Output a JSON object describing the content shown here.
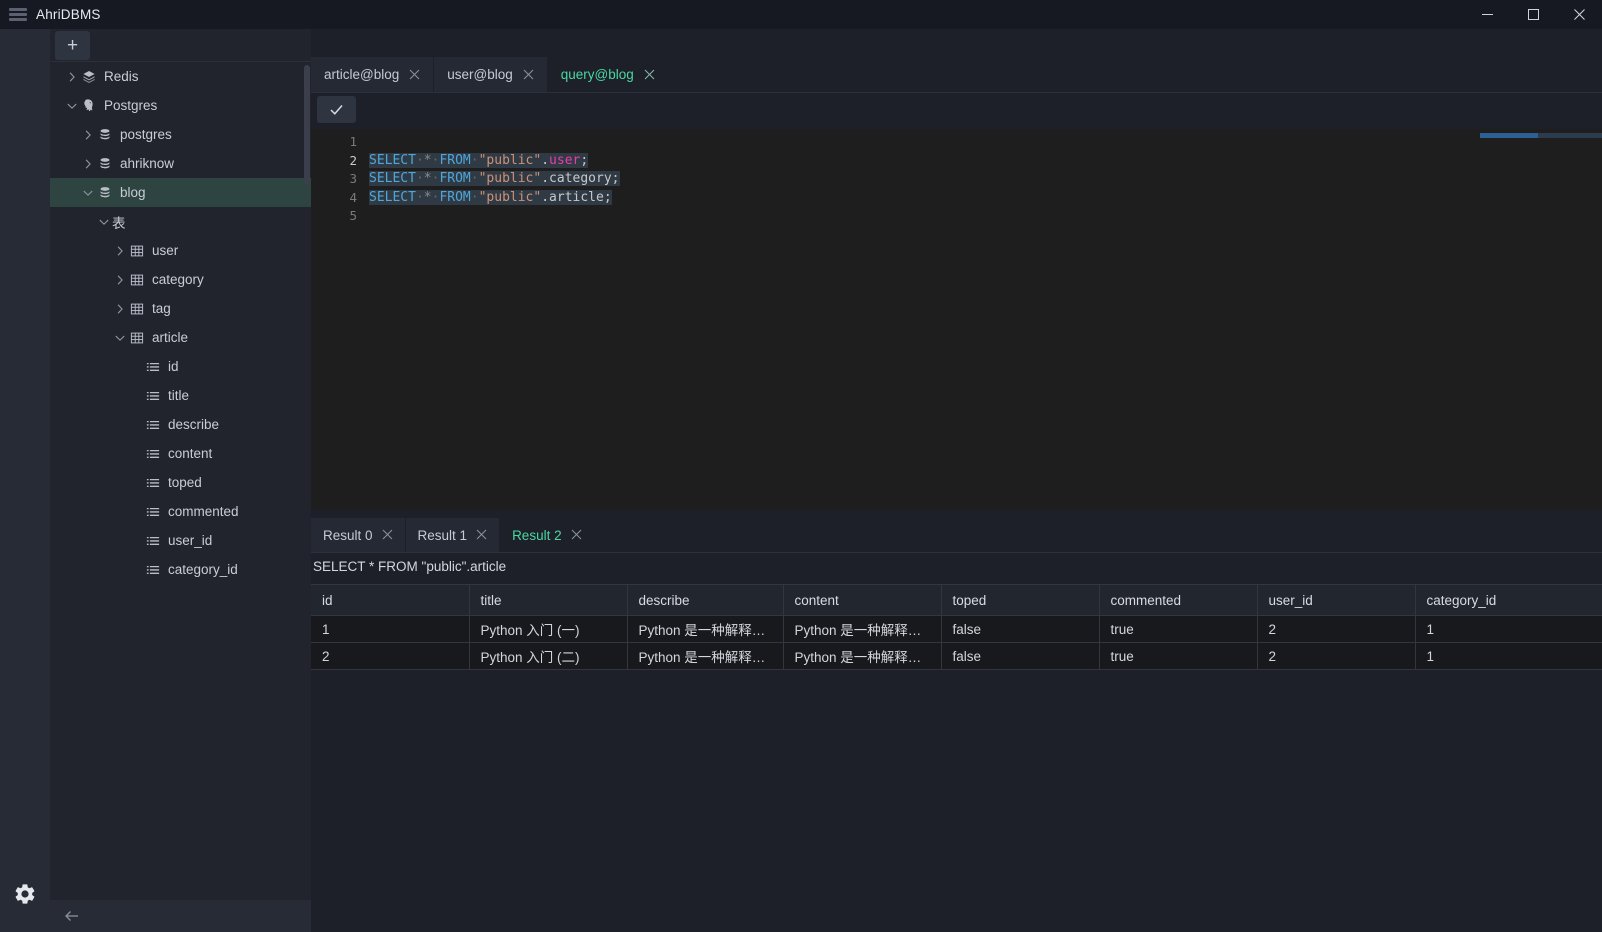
{
  "window": {
    "title": "AhriDBMS",
    "logo_icon": "database-stack-icon",
    "controls": [
      {
        "name": "minimize-button",
        "icon": "minimize-icon"
      },
      {
        "name": "maximize-button",
        "icon": "maximize-icon"
      },
      {
        "name": "close-button",
        "icon": "close-icon"
      }
    ]
  },
  "rail": {
    "settings_icon": "gear-icon"
  },
  "sidebar": {
    "add_tab_label": "+",
    "back_icon": "arrow-left-icon",
    "tree": [
      {
        "label": "Redis",
        "depth": 0,
        "icon": "redis-cube-icon",
        "chevron": "right",
        "selected": false
      },
      {
        "label": "Postgres",
        "depth": 0,
        "icon": "postgres-elephant-icon",
        "chevron": "down",
        "selected": false
      },
      {
        "label": "postgres",
        "depth": 1,
        "icon": "database-icon",
        "chevron": "right",
        "selected": false
      },
      {
        "label": "ahriknow",
        "depth": 1,
        "icon": "database-icon",
        "chevron": "right",
        "selected": false
      },
      {
        "label": "blog",
        "depth": 1,
        "icon": "database-icon",
        "chevron": "down",
        "selected": true
      },
      {
        "label": "表",
        "depth": 2,
        "icon": "none",
        "chevron": "down",
        "selected": false
      },
      {
        "label": "user",
        "depth": 3,
        "icon": "table-icon",
        "chevron": "right",
        "selected": false
      },
      {
        "label": "category",
        "depth": 3,
        "icon": "table-icon",
        "chevron": "right",
        "selected": false
      },
      {
        "label": "tag",
        "depth": 3,
        "icon": "table-icon",
        "chevron": "right",
        "selected": false
      },
      {
        "label": "article",
        "depth": 3,
        "icon": "table-icon",
        "chevron": "down",
        "selected": false
      },
      {
        "label": "id",
        "depth": 4,
        "icon": "column-icon",
        "chevron": "none",
        "selected": false
      },
      {
        "label": "title",
        "depth": 4,
        "icon": "column-icon",
        "chevron": "none",
        "selected": false
      },
      {
        "label": "describe",
        "depth": 4,
        "icon": "column-icon",
        "chevron": "none",
        "selected": false
      },
      {
        "label": "content",
        "depth": 4,
        "icon": "column-icon",
        "chevron": "none",
        "selected": false
      },
      {
        "label": "toped",
        "depth": 4,
        "icon": "column-icon",
        "chevron": "none",
        "selected": false
      },
      {
        "label": "commented",
        "depth": 4,
        "icon": "column-icon",
        "chevron": "none",
        "selected": false
      },
      {
        "label": "user_id",
        "depth": 4,
        "icon": "column-icon",
        "chevron": "none",
        "selected": false
      },
      {
        "label": "category_id",
        "depth": 4,
        "icon": "column-icon",
        "chevron": "none",
        "selected": false
      }
    ]
  },
  "editor": {
    "tabs": [
      {
        "label": "article@blog",
        "active": false,
        "close_icon": "close-icon"
      },
      {
        "label": "user@blog",
        "active": false,
        "close_icon": "close-icon"
      },
      {
        "label": "query@blog",
        "active": true,
        "close_icon": "close-icon"
      }
    ],
    "run_button_icon": "check-icon",
    "line_numbers": [
      "1",
      "2",
      "3",
      "4",
      "5"
    ],
    "current_line": "2",
    "lines": [
      {
        "n": "1",
        "text": ""
      },
      {
        "n": "2",
        "text": "SELECT * FROM \"public\".user;"
      },
      {
        "n": "3",
        "text": "SELECT * FROM \"public\".category;"
      },
      {
        "n": "4",
        "text": "SELECT * FROM \"public\".article;"
      },
      {
        "n": "5",
        "text": ""
      }
    ]
  },
  "results": {
    "tabs": [
      {
        "label": "Result 0",
        "active": false,
        "close_icon": "close-icon"
      },
      {
        "label": "Result 1",
        "active": false,
        "close_icon": "close-icon"
      },
      {
        "label": "Result 2",
        "active": true,
        "close_icon": "close-icon"
      }
    ],
    "query_text": "SELECT * FROM \"public\".article",
    "columns": [
      "id",
      "title",
      "describe",
      "content",
      "toped",
      "commented",
      "user_id",
      "category_id"
    ],
    "rows": [
      [
        "1",
        "Python 入门 (一)",
        "Python 是一种解释型...",
        "Python 是一种解释型...",
        "false",
        "true",
        "2",
        "1"
      ],
      [
        "2",
        "Python 入门 (二)",
        "Python 是一种解释型...",
        "Python 是一种解释型...",
        "false",
        "true",
        "2",
        "1"
      ]
    ]
  },
  "colors": {
    "accent_green": "#4bd6a0",
    "selection_green": "#2e4440",
    "titlebar_bg": "#161922",
    "sidebar_bg": "#21242d",
    "main_bg": "#1d2029",
    "editor_bg": "#1e1e1e",
    "keyword_blue": "#4fa6d9",
    "string_orange": "#ce9178",
    "identifier_pink": "#e83ea5",
    "grid_header_bg": "#22262e",
    "grid_row_bg": "#17191d"
  }
}
